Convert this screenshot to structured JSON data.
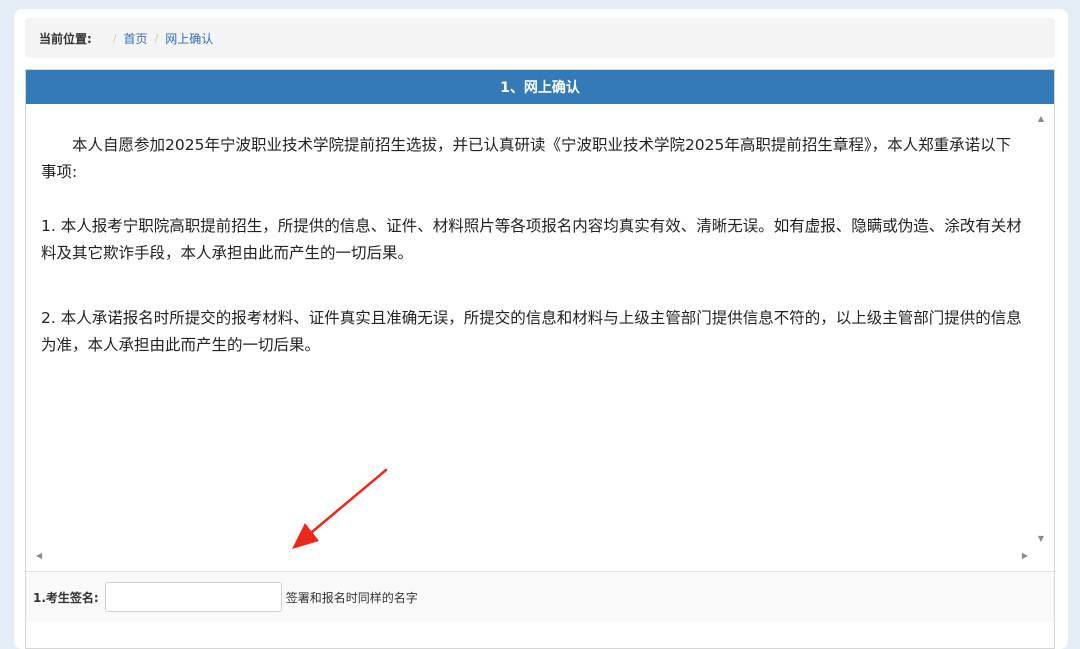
{
  "breadcrumb": {
    "label": "当前位置:",
    "sep1": "/",
    "home": "首页",
    "sep2": "/",
    "current": "网上确认"
  },
  "panel": {
    "title": "1、网上确认"
  },
  "content": {
    "intro": "本人自愿参加2025年宁波职业技术学院提前招生选拔，并已认真研读《宁波职业技术学院2025年高职提前招生章程》，本人郑重承诺以下事项:",
    "item1": "1. 本人报考宁职院高职提前招生，所提供的信息、证件、材料照片等各项报名内容均真实有效、清晰无误。如有虚报、隐瞒或伪造、涂改有关材料及其它欺诈手段，本人承担由此而产生的一切后果。",
    "item2": "2. 本人承诺报名时所提交的报考材料、证件真实且准确无误，所提交的信息和材料与上级主管部门提供信息不符的，以上级主管部门提供的信息为准，本人承担由此而产生的一切后果。"
  },
  "signature": {
    "label": "1.考生签名:",
    "value": "",
    "hint": "签署和报名时同样的名字"
  },
  "icons": {
    "scroll_up": "scroll-up-icon",
    "scroll_down": "scroll-down-icon",
    "scroll_left": "scroll-left-icon",
    "scroll_right": "scroll-right-icon",
    "annotation_arrow": "annotation-arrow"
  },
  "colors": {
    "header_bg": "#337ab7",
    "link": "#2f6fb5",
    "arrow": "#e8291c"
  }
}
